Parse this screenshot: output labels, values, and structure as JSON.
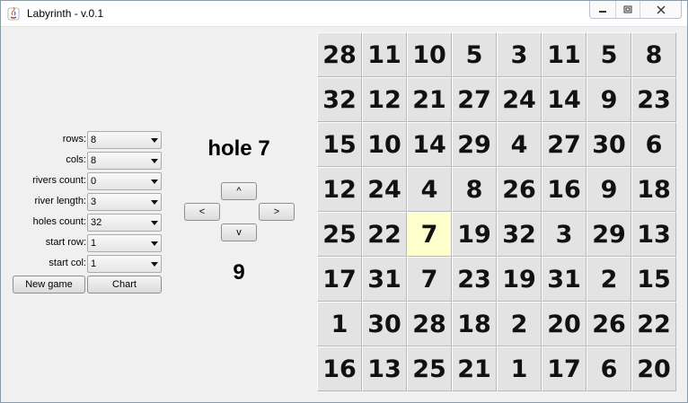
{
  "window": {
    "title": "Labyrinth - v.0.1",
    "minimize_glyph": "▭",
    "maximize_glyph": "▣",
    "close_glyph": "✕"
  },
  "settings": [
    {
      "label": "rows:",
      "value": "8"
    },
    {
      "label": "cols:",
      "value": "8"
    },
    {
      "label": "rivers count:",
      "value": "0"
    },
    {
      "label": "river length:",
      "value": "3"
    },
    {
      "label": "holes count:",
      "value": "32"
    },
    {
      "label": "start row:",
      "value": "1"
    },
    {
      "label": "start col:",
      "value": "1"
    }
  ],
  "actions": {
    "new_game": "New game",
    "chart": "Chart"
  },
  "navigation": {
    "up": "^",
    "left": "<",
    "right": ">",
    "down": "v"
  },
  "status": {
    "hole_label": "hole 7",
    "counter": "9"
  },
  "board": {
    "current_cell": {
      "row": 4,
      "col": 2
    },
    "cells": [
      [
        "28",
        "11",
        "10",
        "5",
        "3",
        "11",
        "5",
        "8"
      ],
      [
        "32",
        "12",
        "21",
        "27",
        "24",
        "14",
        "9",
        "23"
      ],
      [
        "15",
        "10",
        "14",
        "29",
        "4",
        "27",
        "30",
        "6"
      ],
      [
        "12",
        "24",
        "4",
        "8",
        "26",
        "16",
        "9",
        "18"
      ],
      [
        "25",
        "22",
        "7",
        "19",
        "32",
        "3",
        "29",
        "13"
      ],
      [
        "17",
        "31",
        "7",
        "23",
        "19",
        "31",
        "2",
        "15"
      ],
      [
        "1",
        "30",
        "28",
        "18",
        "2",
        "20",
        "26",
        "22"
      ],
      [
        "16",
        "13",
        "25",
        "21",
        "1",
        "17",
        "6",
        "20"
      ]
    ],
    "highlight_color": "#ffffcc"
  }
}
